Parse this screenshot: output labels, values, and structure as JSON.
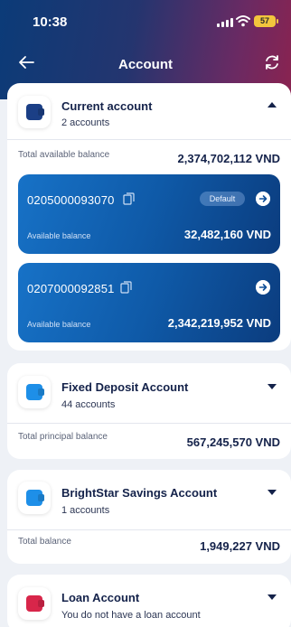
{
  "status": {
    "time": "10:38",
    "battery": "57"
  },
  "nav": {
    "title": "Account"
  },
  "current": {
    "title": "Current account",
    "subtitle": "2 accounts",
    "summary_label": "Total available balance",
    "summary_value": "2,374,702,112 VND",
    "wallet_color": "#1b3f86",
    "accounts": [
      {
        "number": "0205000093070",
        "badge": "Default",
        "balance_label": "Available balance",
        "balance": "32,482,160 VND"
      },
      {
        "number": "0207000092851",
        "balance_label": "Available balance",
        "balance": "2,342,219,952 VND"
      }
    ]
  },
  "fixed": {
    "title": "Fixed Deposit Account",
    "subtitle": "44 accounts",
    "summary_label": "Total principal balance",
    "summary_value": "567,245,570 VND",
    "wallet_color": "#1e8fe8"
  },
  "savings": {
    "title": "BrightStar Savings Account",
    "subtitle": "1 accounts",
    "summary_label": "Total balance",
    "summary_value": "1,949,227 VND",
    "wallet_color": "#1e8fe8"
  },
  "loan": {
    "title": "Loan Account",
    "subtitle": "You do not have a loan account",
    "wallet_color": "#d8264a"
  }
}
